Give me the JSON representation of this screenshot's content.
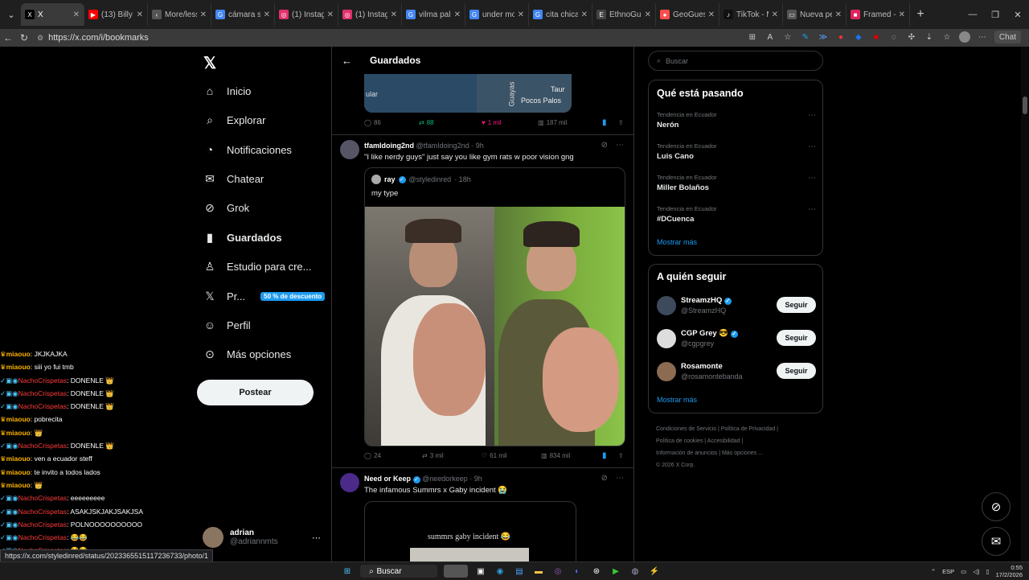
{
  "browser": {
    "tabs": [
      {
        "title": "X",
        "icon": "X",
        "color": "#000000",
        "active": true
      },
      {
        "title": "(13) Billy Idol",
        "icon": "▶",
        "color": "#ff0000"
      },
      {
        "title": "More/less",
        "icon": "‹",
        "color": "#555555"
      },
      {
        "title": "cámara sony",
        "icon": "G",
        "color": "#4285f4"
      },
      {
        "title": "(1) Instagram",
        "icon": "◎",
        "color": "#e1306c"
      },
      {
        "title": "(1) Instagram",
        "icon": "◎",
        "color": "#e1306c"
      },
      {
        "title": "vilma palma",
        "icon": "G",
        "color": "#4285f4"
      },
      {
        "title": "under moving",
        "icon": "G",
        "color": "#4285f4"
      },
      {
        "title": "cita chica ga",
        "icon": "G",
        "color": "#4285f4"
      },
      {
        "title": "EthnoGuessr",
        "icon": "E",
        "color": "#444444"
      },
      {
        "title": "GeoGuessr",
        "icon": "●",
        "color": "#ff4d4d"
      },
      {
        "title": "TikTok - Make",
        "icon": "♪",
        "color": "#111111"
      },
      {
        "title": "Nueva pestaña",
        "icon": "▭",
        "color": "#555555"
      },
      {
        "title": "Framed - #7",
        "icon": "■",
        "color": "#e0245e"
      }
    ],
    "url": "https://x.com/i/bookmarks",
    "chat_label": "Chat"
  },
  "nav": {
    "items": [
      {
        "label": "Inicio",
        "icon": "home-icon",
        "glyph": "⌂"
      },
      {
        "label": "Explorar",
        "icon": "search-icon",
        "glyph": "⌕"
      },
      {
        "label": "Notificaciones",
        "icon": "bell-icon",
        "glyph": "◔"
      },
      {
        "label": "Chatear",
        "icon": "mail-icon",
        "glyph": "✉"
      },
      {
        "label": "Grok",
        "icon": "grok-icon",
        "glyph": "⊘"
      },
      {
        "label": "Guardados",
        "icon": "bookmark-icon",
        "glyph": "▮"
      },
      {
        "label": "Estudio para cre...",
        "icon": "creator-studio-icon",
        "glyph": "♙"
      },
      {
        "label": "Pr...",
        "icon": "x-premium-icon",
        "glyph": "𝕏"
      },
      {
        "label": "Perfil",
        "icon": "profile-icon",
        "glyph": "☺"
      },
      {
        "label": "Más opciones",
        "icon": "more-options-icon",
        "glyph": "⊙"
      }
    ],
    "promo_badge": "50 % de descuento",
    "post_button": "Postear",
    "account": {
      "name": "adrian",
      "handle": "@adriannmts"
    }
  },
  "main": {
    "title": "Guardados",
    "map_labels": {
      "left": "ular",
      "guayas": "Guayas",
      "taur": "Taur",
      "pocos": "Pocos Palos"
    },
    "tweet0_stats": {
      "replies": "86",
      "retweets": "88",
      "likes": "1 mil",
      "views": "187 mil"
    },
    "tweet1": {
      "name": "tfamIdoing2nd",
      "handle": "@tfamIdoing2nd",
      "time": "· 9h",
      "text": "\"I like nerdy guys\" just say you like gym rats w poor vision gng",
      "quote": {
        "name": "ray",
        "handle": "@styledinred",
        "time": "· 18h",
        "text": "my type"
      },
      "stats": {
        "replies": "24",
        "retweets": "3 mil",
        "likes": "61 mil",
        "views": "834 mil"
      }
    },
    "tweet2": {
      "name": "Need or Keep",
      "handle": "@needorkeep",
      "time": "· 9h",
      "text": "The infamous Summrs x Gaby incident 😭",
      "video_caption": "summrs gaby incident 😂"
    }
  },
  "right": {
    "search_placeholder": "Buscar",
    "trends_title": "Qué está pasando",
    "trends": [
      {
        "context": "Tendencia en Ecuador",
        "name": "Nerón"
      },
      {
        "context": "Tendencia en Ecuador",
        "name": "Luis Cano"
      },
      {
        "context": "Tendencia en Ecuador",
        "name": "Miller Bolaños"
      },
      {
        "context": "Tendencia en Ecuador",
        "name": "#DCuenca"
      }
    ],
    "show_more": "Mostrar más",
    "follow_title": "A quién seguir",
    "follow": [
      {
        "name": "StreamzHQ",
        "handle": "@StreamzHQ",
        "color": "#3d4a5c"
      },
      {
        "name": "CGP Grey 😎",
        "handle": "@cgpgrey",
        "color": "#dddddd"
      },
      {
        "name": "Rosamonte",
        "handle": "@rosamontebanda",
        "color": "#8b6b52"
      }
    ],
    "follow_button": "Seguir",
    "footer_line1": "Condiciones de Servicio  |  Política de Privacidad  |",
    "footer_line2": "Política de cookies  |  Accesibilidad  |",
    "footer_line3": "Información de anuncios  |  Más opciones ...",
    "footer_line4": "© 2026 X Corp."
  },
  "chat": [
    {
      "user": "miaouo",
      "msg": ": JKJKAJKA",
      "type": "u1"
    },
    {
      "user": "miaouo",
      "msg": ": siii yo fui tmb",
      "type": "u1"
    },
    {
      "user": "NachoCrispetas",
      "msg": ": DONENLE 👑",
      "type": "u2"
    },
    {
      "user": "NachoCrispetas",
      "msg": ": DONENLE 👑",
      "type": "u2"
    },
    {
      "user": "NachoCrispetas",
      "msg": ": DONENLE 👑",
      "type": "u2"
    },
    {
      "user": "miaouo",
      "msg": ": pobrecita",
      "type": "u1"
    },
    {
      "user": "miaouo",
      "msg": ": 👑",
      "type": "u1"
    },
    {
      "user": "NachoCrispetas",
      "msg": ": DONENLE 👑",
      "type": "u2"
    },
    {
      "user": "miaouo",
      "msg": ": ven a ecuador steff",
      "type": "u1"
    },
    {
      "user": "miaouo",
      "msg": ": te invito a todos lados",
      "type": "u1"
    },
    {
      "user": "miaouo",
      "msg": ": 👑",
      "type": "u1"
    },
    {
      "user": "NachoCrispetas",
      "msg": ": eeeeeeeee",
      "type": "u2"
    },
    {
      "user": "NachoCrispetas",
      "msg": ": ASAKJSKJAKJSAKJSA",
      "type": "u2"
    },
    {
      "user": "NachoCrispetas",
      "msg": ": POLNOOOOOOOOOO",
      "type": "u2"
    },
    {
      "user": "NachoCrispetas",
      "msg": ": 😂😂",
      "type": "u2"
    },
    {
      "user": "NachoCrispetas",
      "msg": ": 😂😂",
      "type": "u2"
    },
    {
      "user": "NachoCrispetas",
      "msg": ": 😂😂",
      "type": "u2"
    }
  ],
  "status_url": "https://x.com/styledinred/status/2023365515117236733/photo/1",
  "taskbar": {
    "search": "Buscar",
    "lang": "ESP",
    "time": "0:55",
    "date": "17/2/2026"
  }
}
